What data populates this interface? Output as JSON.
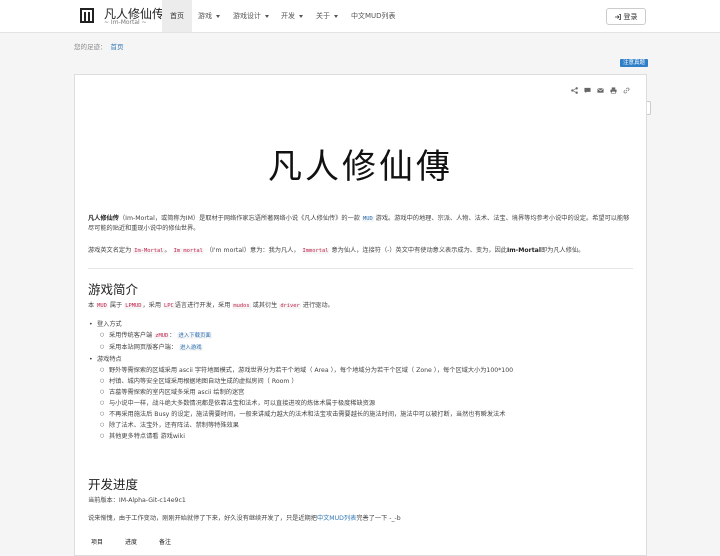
{
  "brand": {
    "title": "凡人修仙传",
    "subtitle": "~ Im-Mortal ~"
  },
  "nav": [
    {
      "label": "首页",
      "caret": false
    },
    {
      "label": "游戏",
      "caret": true
    },
    {
      "label": "游戏设计",
      "caret": true
    },
    {
      "label": "开发",
      "caret": true
    },
    {
      "label": "关于",
      "caret": true
    },
    {
      "label": "中文MUD列表",
      "caret": false
    }
  ],
  "login_label": "登录",
  "breadcrumb": {
    "prefix": "您的足迹：",
    "current": "首页"
  },
  "lang_badge": "注意真题",
  "title_art": "凡人修仙傳",
  "intro": {
    "p1_a": "凡人修仙传",
    "p1_b": "（Im-Mortal，或简称为IM）是取材于网络作家忘语所著网络小说《凡人修仙传》的一款",
    "p1_code": "MUD",
    "p1_c": "游戏。游戏中的地理、宗派、人物、法术、法宝、境界等均参考小说中的设定。希望可以能够尽可能的贴近和重现小说中的修仙世界。",
    "p2_a": "游戏英文名定为",
    "p2_code1": "Im-Mortal",
    "p2_b": "。",
    "p2_code2": "Im mortal",
    "p2_c": "（I'm mortal）意为：我为凡人，",
    "p2_code3": "Immortal",
    "p2_d": "意为仙人，连接符（-）英文中有使动意义表示成为、变为，因此",
    "p2_bold": "Im-Mortal",
    "p2_e": "即为凡人修仙。"
  },
  "section1": {
    "heading": "游戏简介",
    "line_a": "本",
    "code_mud": "MUD",
    "line_b": "属于",
    "code_lpmud": "LPMUD",
    "line_c": "，采用",
    "code_lpc": "LPC",
    "line_d": "语言进行开发，采用",
    "code_mudos": "mudos",
    "line_e": "或其衍生",
    "code_driver": "driver",
    "line_f": "进行驱动。",
    "login_heading": "登入方式",
    "login_items": [
      {
        "text": "采用传统客户端",
        "code": "zMUD",
        "link": "进入下载页面"
      },
      {
        "text": "采用本站网页版客户端：",
        "code": "",
        "link": "进入游戏"
      }
    ],
    "features_heading": "游戏特点",
    "features": [
      "野外等需探索的区域采用 ascii 字符地图模式，游戏世界分为若干个地域（ Area ），每个地域分为若干个区域（ Zone ），每个区域大小为100*100",
      "村镇、城内等安全区域采用根据地图自动生成的虚拟房间（ Room ）",
      "古墓等需探索的室内区域多采用 ascii 绘制的迷宫",
      "与小说中一样，战斗绝大多数情况都是依靠法宝和法术，可以直接进攻的炼体术属于极度稀缺资源",
      "不再采用施法后 Busy 的设定，施法需要时间，一般来讲威力越大的法术和法宝攻击需要越长的施法时间，施法中可以被打断，当然也有瞬发法术",
      "除了法术、法宝外，还有阵法、禁制等特殊效果",
      "其他更多特点请看 游戏wiki"
    ]
  },
  "section2": {
    "heading": "开发进度",
    "version": "当前版本：IM-Alpha-Git-c14e9c1",
    "progress_a": "说来惭愧，由于工作变动，刚刚开始就停了下来，好久没有继续开发了，只是近期把",
    "progress_link": "中文MUD列表",
    "progress_b": "完善了一下 -_-b",
    "table_headers": [
      "项目",
      "进度",
      "备注"
    ]
  }
}
